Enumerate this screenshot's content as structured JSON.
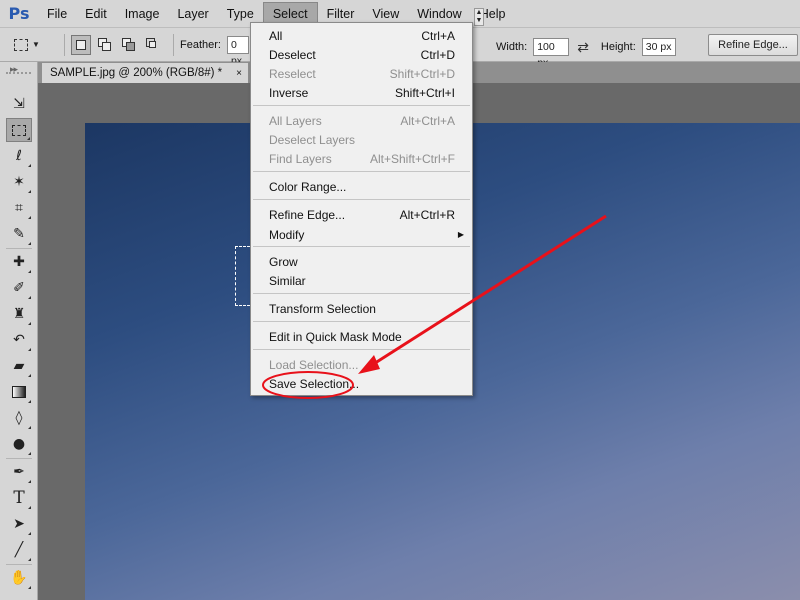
{
  "app": {
    "logo": "Ps"
  },
  "menubar": {
    "items": [
      "File",
      "Edit",
      "Image",
      "Layer",
      "Type",
      "Select",
      "Filter",
      "View",
      "Window",
      "Help"
    ],
    "active": "Select"
  },
  "options": {
    "feather_label": "Feather:",
    "feather_value": "0 px",
    "width_label": "Width:",
    "width_value": "100 px",
    "height_label": "Height:",
    "height_value": "30 px",
    "refine_edge_label": "Refine Edge...",
    "swap_icon": "swap-arrows-icon"
  },
  "document": {
    "tab_title": "SAMPLE.jpg @ 200% (RGB/8#) *",
    "close_glyph": "×"
  },
  "select_menu": {
    "items": [
      {
        "label": "All",
        "shortcut": "Ctrl+A",
        "disabled": false
      },
      {
        "label": "Deselect",
        "shortcut": "Ctrl+D",
        "disabled": false
      },
      {
        "label": "Reselect",
        "shortcut": "Shift+Ctrl+D",
        "disabled": true
      },
      {
        "label": "Inverse",
        "shortcut": "Shift+Ctrl+I",
        "disabled": false
      },
      {
        "label": "All Layers",
        "shortcut": "Alt+Ctrl+A",
        "disabled": true
      },
      {
        "label": "Deselect Layers",
        "shortcut": "",
        "disabled": true
      },
      {
        "label": "Find Layers",
        "shortcut": "Alt+Shift+Ctrl+F",
        "disabled": true
      },
      {
        "label": "Color Range...",
        "shortcut": "",
        "disabled": false
      },
      {
        "label": "Refine Edge...",
        "shortcut": "Alt+Ctrl+R",
        "disabled": false
      },
      {
        "label": "Modify",
        "shortcut": "",
        "disabled": false,
        "submenu": true
      },
      {
        "label": "Grow",
        "shortcut": "",
        "disabled": false
      },
      {
        "label": "Similar",
        "shortcut": "",
        "disabled": false
      },
      {
        "label": "Transform Selection",
        "shortcut": "",
        "disabled": false
      },
      {
        "label": "Edit in Quick Mask Mode",
        "shortcut": "",
        "disabled": false
      },
      {
        "label": "Load Selection...",
        "shortcut": "",
        "disabled": true
      },
      {
        "label": "Save Selection...",
        "shortcut": "",
        "disabled": false,
        "highlighted_annotation": true
      }
    ]
  },
  "tools": [
    "move-icon",
    "rect-marquee-icon",
    "lasso-icon",
    "magic-wand-icon",
    "crop-icon",
    "eyedropper-icon",
    "healing-brush-icon",
    "brush-icon",
    "clone-stamp-icon",
    "history-brush-icon",
    "eraser-icon",
    "gradient-icon",
    "blur-icon",
    "dodge-icon",
    "pen-icon",
    "type-icon",
    "path-selection-icon",
    "line-icon",
    "hand-icon"
  ],
  "colors": {
    "annotation_red": "#e8111a",
    "menubar_bg": "#d6d6d6",
    "menu_bg": "#f0f0f0",
    "ps_blue": "#2a5bb0"
  }
}
